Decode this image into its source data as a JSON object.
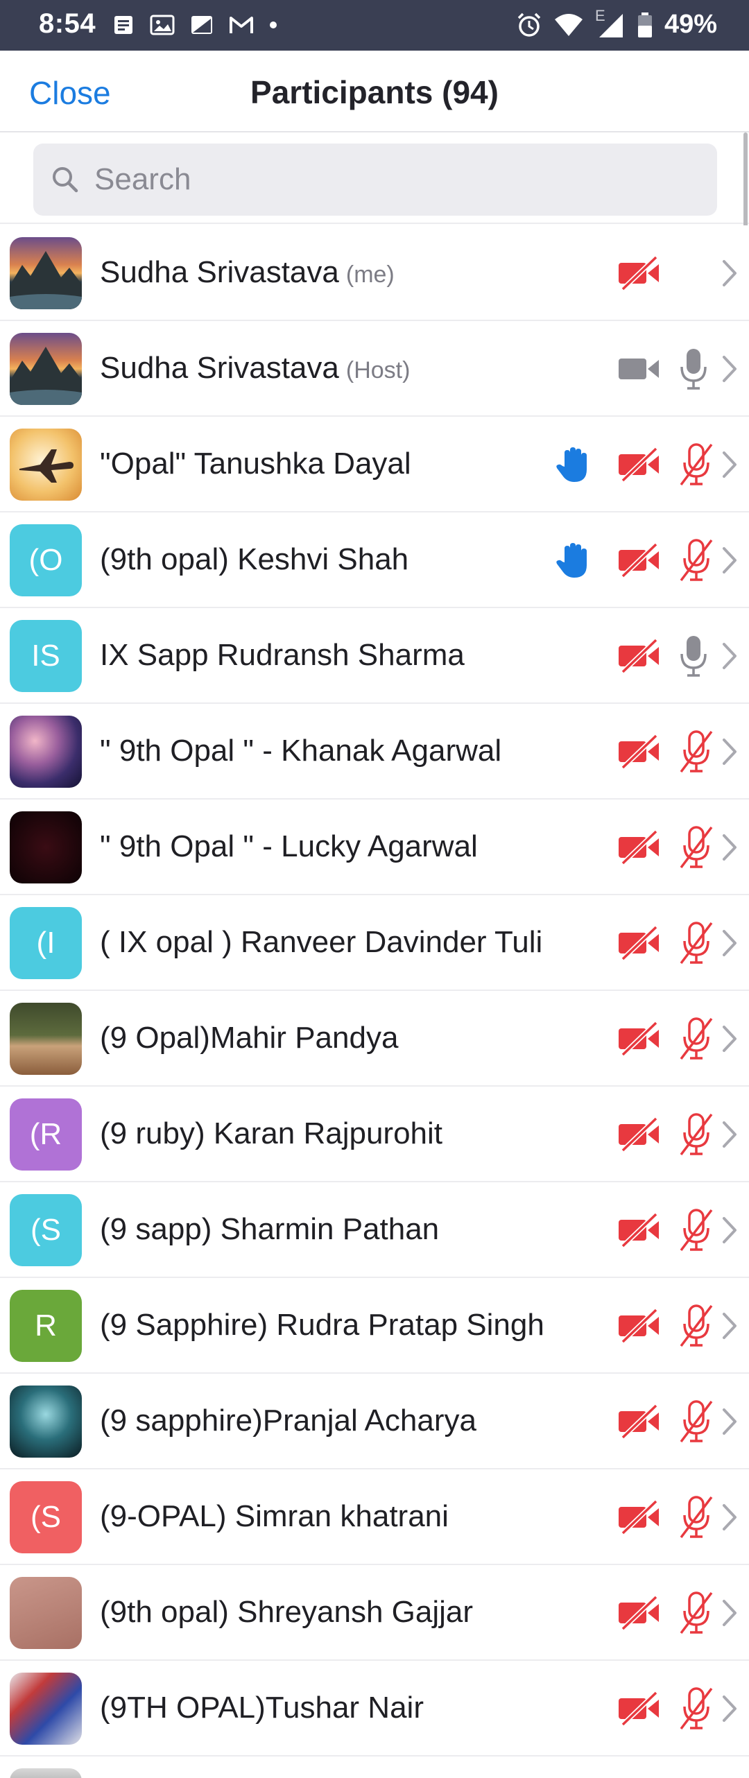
{
  "status_bar": {
    "time": "8:54",
    "network_label": "E",
    "battery": "49%",
    "icons_left": [
      "news-icon",
      "photo-icon",
      "image-icon",
      "gmail-icon",
      "dot-icon"
    ],
    "icons_right": [
      "alarm-icon",
      "wifi-icon",
      "signal-icon",
      "battery-icon"
    ]
  },
  "header": {
    "close_label": "Close",
    "title": "Participants (94)"
  },
  "search": {
    "placeholder": "Search",
    "value": ""
  },
  "colors": {
    "accent": "#1b7ce0",
    "muted_red": "#e8393f",
    "gray_icon": "#8c8c93",
    "status_bar": "#3a3f53"
  },
  "participants": [
    {
      "name": "Sudha Srivastava",
      "tag": "(me)",
      "avatar": {
        "type": "image",
        "style": "sunset"
      },
      "hand": false,
      "video": "off",
      "audio": "none"
    },
    {
      "name": "Sudha Srivastava",
      "tag": "(Host)",
      "avatar": {
        "type": "image",
        "style": "sunset"
      },
      "hand": false,
      "video": "on",
      "audio": "on"
    },
    {
      "name": "\"Opal\" Tanushka Dayal",
      "tag": "",
      "avatar": {
        "type": "image",
        "style": "plane"
      },
      "hand": true,
      "video": "off",
      "audio": "muted"
    },
    {
      "name": "(9th opal) Keshvi Shah",
      "tag": "",
      "avatar": {
        "type": "initials",
        "text": "(O",
        "color": "#4ccbe0"
      },
      "hand": true,
      "video": "off",
      "audio": "muted"
    },
    {
      "name": "IX Sapp Rudransh Sharma",
      "tag": "",
      "avatar": {
        "type": "initials",
        "text": "IS",
        "color": "#4ccbe0"
      },
      "hand": false,
      "video": "off",
      "audio": "on"
    },
    {
      "name": "\" 9th Opal \" - Khanak Agarwal",
      "tag": "",
      "avatar": {
        "type": "image",
        "style": "nebula"
      },
      "hand": false,
      "video": "off",
      "audio": "muted"
    },
    {
      "name": "\" 9th Opal \" - Lucky Agarwal",
      "tag": "",
      "avatar": {
        "type": "image",
        "style": "dark"
      },
      "hand": false,
      "video": "off",
      "audio": "muted"
    },
    {
      "name": "( IX opal ) Ranveer Davinder Tuli",
      "tag": "",
      "avatar": {
        "type": "initials",
        "text": "(I",
        "color": "#4ccbe0"
      },
      "hand": false,
      "video": "off",
      "audio": "muted"
    },
    {
      "name": "(9 Opal)Mahir Pandya",
      "tag": "",
      "avatar": {
        "type": "image",
        "style": "portrait"
      },
      "hand": false,
      "video": "off",
      "audio": "muted"
    },
    {
      "name": "(9 ruby) Karan Rajpurohit",
      "tag": "",
      "avatar": {
        "type": "initials",
        "text": "(R",
        "color": "#b072d6"
      },
      "hand": false,
      "video": "off",
      "audio": "muted"
    },
    {
      "name": "(9 sapp) Sharmin Pathan",
      "tag": "",
      "avatar": {
        "type": "initials",
        "text": "(S",
        "color": "#4ccbe0"
      },
      "hand": false,
      "video": "off",
      "audio": "muted"
    },
    {
      "name": "(9 Sapphire) Rudra Pratap Singh",
      "tag": "",
      "avatar": {
        "type": "initials",
        "text": "R",
        "color": "#6aa83a"
      },
      "hand": false,
      "video": "off",
      "audio": "muted"
    },
    {
      "name": "(9 sapphire)Pranjal Acharya",
      "tag": "",
      "avatar": {
        "type": "image",
        "style": "lion"
      },
      "hand": false,
      "video": "off",
      "audio": "muted"
    },
    {
      "name": "(9-OPAL) Simran khatrani",
      "tag": "",
      "avatar": {
        "type": "initials",
        "text": "(S",
        "color": "#f06062"
      },
      "hand": false,
      "video": "off",
      "audio": "muted"
    },
    {
      "name": "(9th opal) Shreyansh Gajjar",
      "tag": "",
      "avatar": {
        "type": "image",
        "style": "skin"
      },
      "hand": false,
      "video": "off",
      "audio": "muted"
    },
    {
      "name": "(9TH OPAL)Tushar Nair",
      "tag": "",
      "avatar": {
        "type": "image",
        "style": "poster"
      },
      "hand": false,
      "video": "off",
      "audio": "muted"
    }
  ]
}
